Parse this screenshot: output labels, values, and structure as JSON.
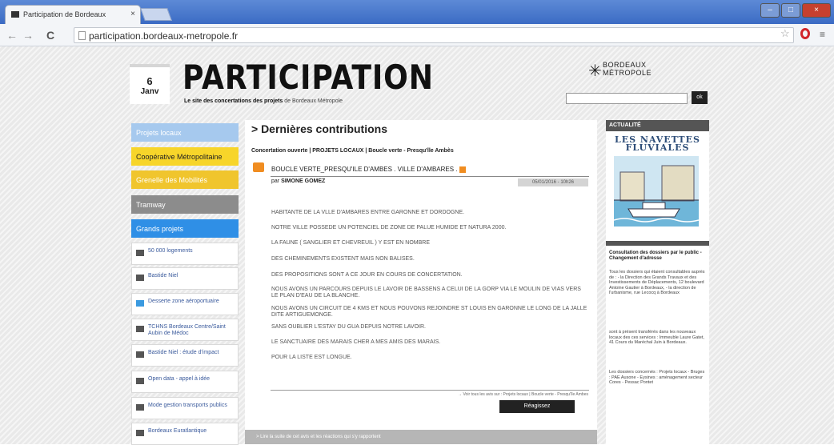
{
  "browser": {
    "tab_title": "Participation de Bordeaux",
    "tab_close": "×",
    "url": "participation.bordeaux-metropole.fr",
    "win_min": "–",
    "win_max": "□",
    "win_close": "×"
  },
  "header": {
    "date_day": "6",
    "date_month": "Janv",
    "site_title": "PARTICIPATION",
    "tagline_bold": "Le site des concertations des projets",
    "tagline_rest": " de Bordeaux Métropole",
    "logo_line1": "BORDEAUX",
    "logo_line2": "MÉTROPOLE",
    "search_button": "ok"
  },
  "left_nav": [
    {
      "label": "Projets locaux",
      "color": "#a6c9ee"
    },
    {
      "label": "Coopérative Métropolitaine",
      "color": "#f7d52a"
    },
    {
      "label": "Grenelle des Mobilités",
      "color": "#f0c52d"
    },
    {
      "label": "Tramway",
      "color": "#8c8c8c"
    },
    {
      "label": "Grands projets",
      "color": "#2f8fe6"
    }
  ],
  "projects": [
    {
      "label": "50 000 logements",
      "icon": "comment-icon"
    },
    {
      "label": "Bastide Niel",
      "icon": "comment-icon"
    },
    {
      "label": "Desserte zone aéroportuaire",
      "icon": "comment-blue-icon"
    },
    {
      "label": "TCHNS Bordeaux Centre/Saint Aubin de Médoc",
      "icon": "comment-icon"
    },
    {
      "label": "Bastide Niel : étude d'impact",
      "icon": "comment-icon"
    },
    {
      "label": "Open data - appel à idée",
      "icon": "comment-icon"
    },
    {
      "label": "Mode gestion transports publics",
      "icon": "comment-icon"
    },
    {
      "label": "Bordeaux Euratlantique",
      "icon": "comment-icon"
    }
  ],
  "main": {
    "title": "> Dernières contributions",
    "subtitle": "Concertation ouverte | PROJETS LOCAUX | Boucle verte - Presqu'île Ambès",
    "post_title": "BOUCLE VERTE_PRESQU'ILE D'AMBES . VILLE D'AMBARES .",
    "author_prefix": "par ",
    "author": "SIMONE GOMEZ",
    "date": "05/01/2016 - 10h26",
    "paragraphs": [
      "HABITANTE DE LA VLLE D'AMBARES ENTRE GARONNE ET DORDOGNE.",
      "NOTRE VILLE POSSEDE UN POTENCIEL DE ZONE DE PALUE HUMIDE ET NATURA 2000.",
      "LA FAUNE ( SANGLIER ET CHEVREUIL ) Y EST EN NOMBRE",
      "DES CHEMINEMENTS EXISTENT MAIS NON BALISES.",
      "DES PROPOSITIONS SONT A CE JOUR EN COURS DE CONCERTATION.",
      "NOUS AVONS UN PARCOURS DEPUIS LE LAVOIR DE BASSENS A CELUI DE LA GORP VIA LE MOULIN DE VIAS VERS LE PLAN D'EAU DE LA BLANCHE.",
      "NOUS AVONS UN CIRCUIT DE 4 KMS ET NOUS POUVONS REJOINDRE ST LOUIS EN GARONNE LE LONG DE LA JALLE DITE ARTIGUEMONGE.",
      "SANS OUBLIER L'ESTAY DU GUA DEPUIS NOTRE LAVOIR.",
      "LE SANCTUAIRE DES MARAIS CHER A MES AMIS DES MARAIS.",
      "POUR LA LISTE EST LONGUE."
    ],
    "all_link": "→ Voir tous les avis sur : Projets locaux | Boucle verte - Presqu'île Ambes",
    "reply_button": "Réagissez",
    "more_link": "> Lire la suite de cet avis et les réactions qui s'y rapportent"
  },
  "sidebar": {
    "heading": "ACTUALITÉ",
    "promo_line1": "LES NAVETTES",
    "promo_line2": "FLUVIALES",
    "news_title": "Consultation des dossiers par le public - Changement d'adresse",
    "news_p1": "Tous les dossiers qui étaient consultables auprès de : - la Direction des Grands Travaux et des Investissements de Déplacements, 12 boulevard Antoine Gautier à Bordeaux, - la direction de l'urbanisme, rue Lecocq à Bordeaux",
    "news_p2": "sont à présent transférés dans les nouveaux locaux des ces services : Immeuble Laure Gatet, 41 Cours du Maréchal Juin à Bordeaux.",
    "news_p3": "Les dossiers concernés : Projets locaux - Bruges : PAE Ausone - Eysines : aménagement secteur Cores - Pessac Pontet"
  }
}
